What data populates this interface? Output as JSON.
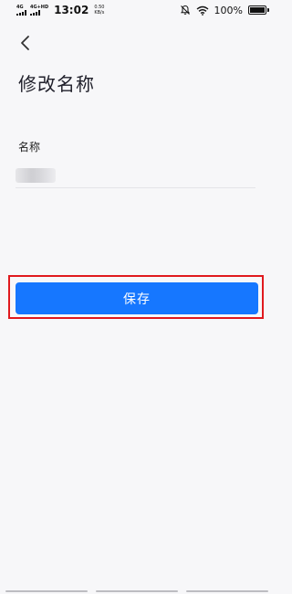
{
  "status_bar": {
    "sig1": "4G",
    "sig2": "4G+HD",
    "time": "13:02",
    "net_speed_value": "0.50",
    "net_speed_unit": "KB/s",
    "battery_percent": "100%",
    "battery_level": 1.0
  },
  "header": {
    "title": "修改名称"
  },
  "form": {
    "name_label": "名称"
  },
  "actions": {
    "save_label": "保存"
  },
  "colors": {
    "accent": "#1677ff",
    "highlight": "#e0191e"
  }
}
